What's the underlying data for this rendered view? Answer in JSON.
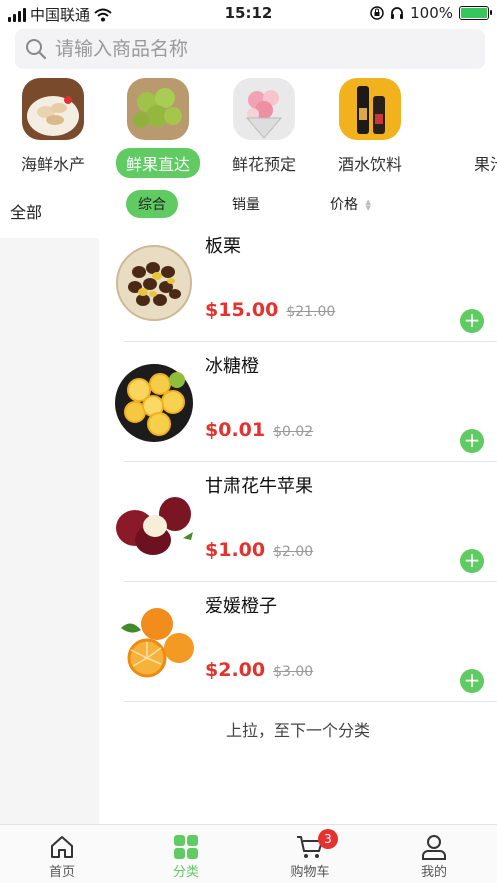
{
  "status_bar": {
    "carrier": "中国联通",
    "time": "15:12",
    "battery": "100%"
  },
  "search": {
    "placeholder": "请输入商品名称"
  },
  "categories": [
    {
      "label": "海鲜水产",
      "active": false
    },
    {
      "label": "鲜果直达",
      "active": true
    },
    {
      "label": "鲜花预定",
      "active": false
    },
    {
      "label": "酒水饮料",
      "active": false
    },
    {
      "label": "果汁",
      "active": false
    }
  ],
  "sidebar": {
    "items": [
      {
        "label": "全部",
        "active": true
      }
    ]
  },
  "sort": {
    "comprehensive": "综合",
    "sales": "销量",
    "price": "价格"
  },
  "products": [
    {
      "name": "板栗",
      "price": "$15.00",
      "original_price": "$21.00",
      "image": "chestnut"
    },
    {
      "name": "冰糖橙",
      "price": "$0.01",
      "original_price": "$0.02",
      "image": "orange-halves"
    },
    {
      "name": "甘肃花牛苹果",
      "price": "$1.00",
      "original_price": "$2.00",
      "image": "red-apple"
    },
    {
      "name": "爱媛橙子",
      "price": "$2.00",
      "original_price": "$3.00",
      "image": "oranges"
    }
  ],
  "list_footer": "上拉，至下一个分类",
  "tabbar": {
    "items": [
      {
        "label": "首页",
        "icon": "home-icon"
      },
      {
        "label": "分类",
        "icon": "grid-icon",
        "active": true
      },
      {
        "label": "购物车",
        "icon": "cart-icon",
        "badge": "3"
      },
      {
        "label": "我的",
        "icon": "user-icon"
      }
    ]
  },
  "colors": {
    "accent": "#5fcb62",
    "price": "#e2332f"
  }
}
